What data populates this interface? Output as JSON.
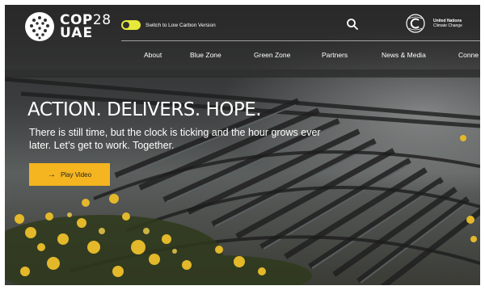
{
  "header": {
    "logo": {
      "line1_bold": "COP",
      "line1_thin": "28",
      "line2": "UAE"
    },
    "low_carbon_toggle": {
      "label": "Switch to Low Carbon Version",
      "on": true
    },
    "search_icon": "search-icon",
    "unfccc": {
      "line1": "United Nations",
      "line2": "Climate Change"
    }
  },
  "nav": {
    "items": [
      {
        "label": "About"
      },
      {
        "label": "Blue Zone"
      },
      {
        "label": "Green Zone"
      },
      {
        "label": "Partners"
      },
      {
        "label": "News & Media"
      },
      {
        "label": "Conne"
      }
    ]
  },
  "hero": {
    "headline": "ACTION. DELIVERS. HOPE.",
    "tagline": "There is still time, but the clock is ticking and the hour grows ever later. Let’s get to work. Together.",
    "play_button": {
      "label": "Play Video",
      "icon": "arrow-right-icon"
    }
  },
  "colors": {
    "accent": "#f5b520",
    "toggle": "#e7e93a",
    "header_bg": "#2f2f2f",
    "text": "#ffffff"
  }
}
